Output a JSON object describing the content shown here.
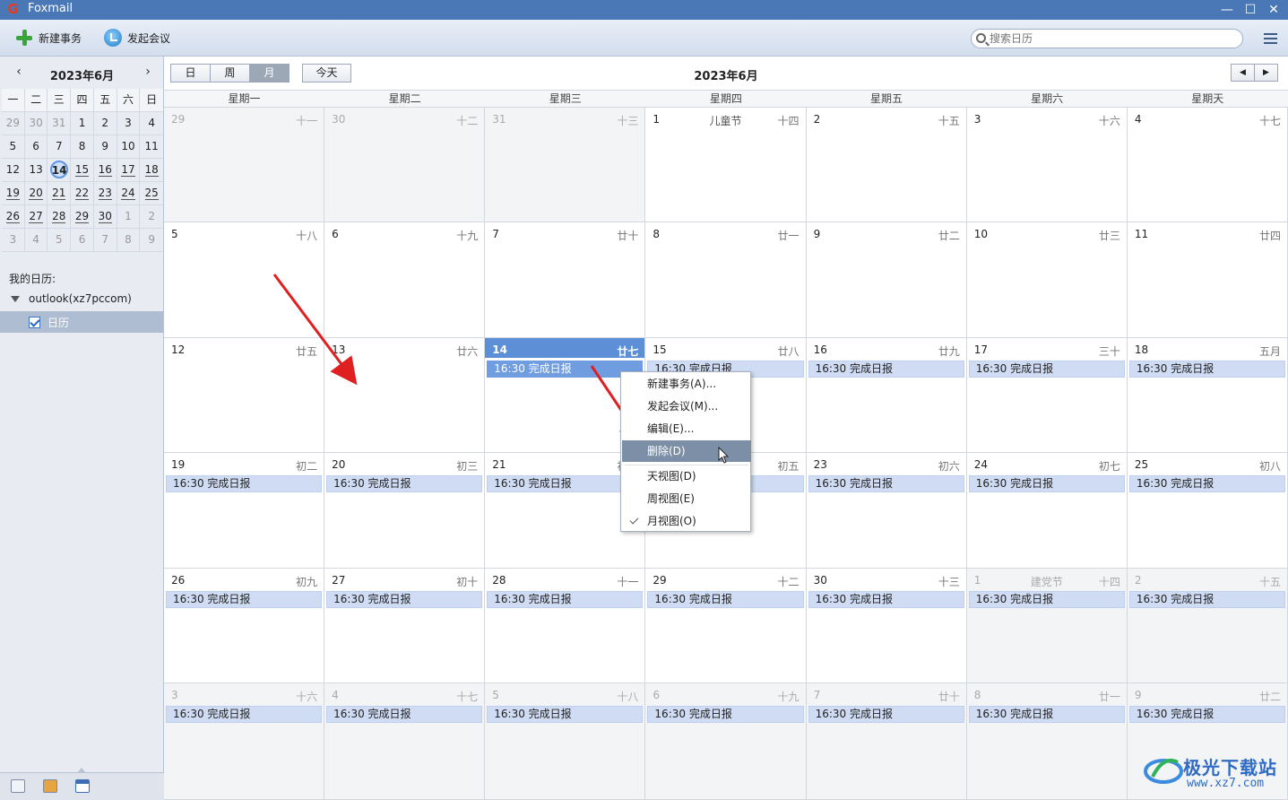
{
  "app": {
    "title": "Foxmail",
    "window_controls": [
      "—",
      "☐",
      "✕"
    ]
  },
  "toolbar": {
    "new_task": "新建事务",
    "new_meeting": "发起会议",
    "search_placeholder": "搜索日历"
  },
  "sidebar": {
    "mini_title": "2023年6月",
    "prev": "‹",
    "next": "›",
    "weekdays": [
      "一",
      "二",
      "三",
      "四",
      "五",
      "六",
      "日"
    ],
    "weeks": [
      [
        "29",
        "30",
        "31",
        "1",
        "2",
        "3",
        "4"
      ],
      [
        "5",
        "6",
        "7",
        "8",
        "9",
        "10",
        "11"
      ],
      [
        "12",
        "13",
        "14",
        "15",
        "16",
        "17",
        "18"
      ],
      [
        "19",
        "20",
        "21",
        "22",
        "23",
        "24",
        "25"
      ],
      [
        "26",
        "27",
        "28",
        "29",
        "30",
        "1",
        "2"
      ],
      [
        "3",
        "4",
        "5",
        "6",
        "7",
        "8",
        "9"
      ]
    ],
    "my_calendars": "我的日历:",
    "account": "outlook(xz7pccom)",
    "calendar_name": "日历"
  },
  "main": {
    "views": [
      "日",
      "周",
      "月"
    ],
    "active_view": "月",
    "today_btn": "今天",
    "title": "2023年6月",
    "prev": "◀",
    "next": "▶",
    "weekdays": [
      "星期一",
      "星期二",
      "星期三",
      "星期四",
      "星期五",
      "星期六",
      "星期天"
    ]
  },
  "month": [
    [
      {
        "d": "29",
        "l": "十一",
        "other": true
      },
      {
        "d": "30",
        "l": "十二",
        "other": true
      },
      {
        "d": "31",
        "l": "十三",
        "other": true
      },
      {
        "d": "1",
        "l": "十四",
        "h": "儿童节"
      },
      {
        "d": "2",
        "l": "十五"
      },
      {
        "d": "3",
        "l": "十六"
      },
      {
        "d": "4",
        "l": "十七"
      }
    ],
    [
      {
        "d": "5",
        "l": "十八"
      },
      {
        "d": "6",
        "l": "十九"
      },
      {
        "d": "7",
        "l": "廿十"
      },
      {
        "d": "8",
        "l": "廿一"
      },
      {
        "d": "9",
        "l": "廿二"
      },
      {
        "d": "10",
        "l": "廿三"
      },
      {
        "d": "11",
        "l": "廿四"
      }
    ],
    [
      {
        "d": "12",
        "l": "廿五"
      },
      {
        "d": "13",
        "l": "廿六"
      },
      {
        "d": "14",
        "l": "廿七",
        "sel": true,
        "ev": "16:30 完成日报"
      },
      {
        "d": "15",
        "l": "廿八",
        "ev": "16:30 完成日报"
      },
      {
        "d": "16",
        "l": "廿九",
        "ev": "16:30 完成日报"
      },
      {
        "d": "17",
        "l": "三十",
        "ev": "16:30 完成日报"
      },
      {
        "d": "18",
        "l": "五月",
        "ev": "16:30 完成日报"
      }
    ],
    [
      {
        "d": "19",
        "l": "初二",
        "ev": "16:30 完成日报"
      },
      {
        "d": "20",
        "l": "初三",
        "ev": "16:30 完成日报"
      },
      {
        "d": "21",
        "l": "初四",
        "ev": "16:30 完成日报"
      },
      {
        "d": "22",
        "l": "初五",
        "ev": "16:30 完成日报"
      },
      {
        "d": "23",
        "l": "初六",
        "ev": "16:30 完成日报"
      },
      {
        "d": "24",
        "l": "初七",
        "ev": "16:30 完成日报"
      },
      {
        "d": "25",
        "l": "初八",
        "ev": "16:30 完成日报"
      }
    ],
    [
      {
        "d": "26",
        "l": "初九",
        "ev": "16:30 完成日报"
      },
      {
        "d": "27",
        "l": "初十",
        "ev": "16:30 完成日报"
      },
      {
        "d": "28",
        "l": "十一",
        "ev": "16:30 完成日报"
      },
      {
        "d": "29",
        "l": "十二",
        "ev": "16:30 完成日报"
      },
      {
        "d": "30",
        "l": "十三",
        "ev": "16:30 完成日报"
      },
      {
        "d": "1",
        "l": "十四",
        "h": "建党节",
        "other": true,
        "ev": "16:30 完成日报"
      },
      {
        "d": "2",
        "l": "十五",
        "other": true,
        "ev": "16:30 完成日报"
      }
    ],
    [
      {
        "d": "3",
        "l": "十六",
        "other": true,
        "ev": "16:30 完成日报"
      },
      {
        "d": "4",
        "l": "十七",
        "other": true,
        "ev": "16:30 完成日报"
      },
      {
        "d": "5",
        "l": "十八",
        "other": true,
        "ev": "16:30 完成日报"
      },
      {
        "d": "6",
        "l": "十九",
        "other": true,
        "ev": "16:30 完成日报"
      },
      {
        "d": "7",
        "l": "廿十",
        "other": true,
        "ev": "16:30 完成日报"
      },
      {
        "d": "8",
        "l": "廿一",
        "other": true,
        "ev": "16:30 完成日报"
      },
      {
        "d": "9",
        "l": "廿二",
        "other": true,
        "ev": "16:30 完成日报"
      }
    ]
  ],
  "context_menu": {
    "items": [
      "新建事务(A)...",
      "发起会议(M)...",
      "编辑(E)...",
      "删除(D)",
      "天视图(D)",
      "周视图(E)",
      "月视图(O)"
    ],
    "highlighted": "删除(D)",
    "checked": "月视图(O)"
  },
  "watermark": {
    "text": "极光下载站",
    "url": "www.xz7.com"
  },
  "colors": {
    "titlebar": "#4a78b6",
    "selected_day": "#5d8fd6",
    "event": "#cfdcf4",
    "arrow": "#e02020"
  }
}
